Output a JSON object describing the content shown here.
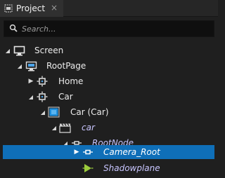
{
  "panel": {
    "tab_title": "Project",
    "tab_icon": "project-panel-icon",
    "close_glyph": "×"
  },
  "search": {
    "placeholder": "Search...",
    "value": ""
  },
  "tree": {
    "items": [
      {
        "label": "Screen",
        "icon": "monitor-icon",
        "expanded": true,
        "italic": false,
        "selected": false
      },
      {
        "label": "RootPage",
        "icon": "page-icon",
        "expanded": true,
        "italic": false,
        "selected": false
      },
      {
        "label": "Home",
        "icon": "node-icon",
        "expanded": false,
        "italic": false,
        "selected": false
      },
      {
        "label": "Car",
        "icon": "node-icon",
        "expanded": true,
        "italic": false,
        "selected": false
      },
      {
        "label": "Car (Car)",
        "icon": "model-icon",
        "expanded": true,
        "italic": false,
        "selected": false
      },
      {
        "label": "car",
        "icon": "clapper-icon",
        "expanded": true,
        "italic": true,
        "selected": false
      },
      {
        "label": "RootNode",
        "icon": "node-dot-icon",
        "expanded": true,
        "italic": true,
        "selected": false
      },
      {
        "label": "Camera_Root",
        "icon": "node-icon",
        "expanded": false,
        "italic": true,
        "selected": true
      },
      {
        "label": "Shadowplane",
        "icon": "mesh-icon",
        "expanded": null,
        "italic": true,
        "selected": false
      }
    ]
  },
  "colors": {
    "background": "#1f1f1f",
    "selection": "#0f6fb8",
    "italic_text": "#c9c3ff",
    "accent_green": "#9ccc3c"
  }
}
